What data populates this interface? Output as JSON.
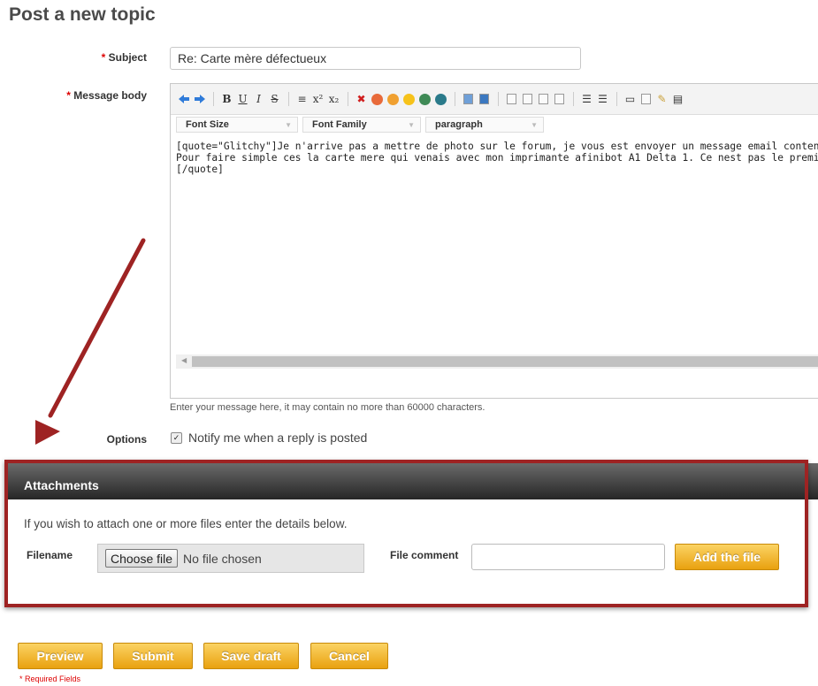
{
  "page": {
    "title": "Post a new topic"
  },
  "form": {
    "required_star": "*",
    "subject_label": "Subject",
    "subject_value": "Re: Carte mère défectueux",
    "message_label": "Message body",
    "editor": {
      "font_size_label": "Font Size",
      "font_family_label": "Font Family",
      "format_label": "paragraph",
      "content": "[quote=\"Glitchy\"]Je n'arrive pas a mettre de photo sur le forum, je vous est envoyer un message email contenant des p\nPour faire simple ces la carte mere qui venais avec mon imprimante afinibot A1 Delta 1. Ce nest pas le premier soucis q\n[/quote]"
    },
    "hint": "Enter your message here, it may contain no more than 60000 characters.",
    "options_label": "Options",
    "notify_label": "Notify me when a reply is posted",
    "notify_checked": true
  },
  "attachments": {
    "title": "Attachments",
    "instructions": "If you wish to attach one or more files enter the details below.",
    "filename_label": "Filename",
    "choose_file": "Choose file",
    "no_file": "No file chosen",
    "comment_label": "File comment",
    "add_button": "Add the file"
  },
  "buttons": {
    "preview": "Preview",
    "submit": "Submit",
    "save_draft": "Save draft",
    "cancel": "Cancel"
  },
  "required_note": "* Required Fields",
  "colors": {
    "button_top": "#fbd363",
    "button_bottom": "#e9a10f",
    "highlight_frame": "#9e2323",
    "required": "#dd0000"
  },
  "icons": [
    "arrow-left-icon",
    "arrow-right-icon",
    "bold-icon",
    "underline-icon",
    "italic-icon",
    "strikethrough-icon",
    "horizontal-rule-icon",
    "superscript-icon",
    "subscript-icon",
    "remove-format-icon",
    "emoticon-icon",
    "link-icon",
    "unlink-icon",
    "image-icon",
    "media-icon",
    "align-icon",
    "list-icon",
    "quote-icon",
    "code-icon"
  ]
}
